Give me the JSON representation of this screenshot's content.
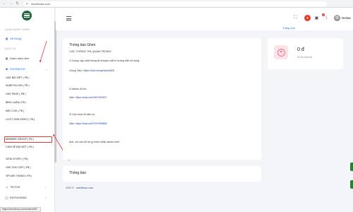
{
  "browser": {
    "url": "new.fbnuu.com"
  },
  "sidebar": {
    "section_admin": "QUẢN HÀNH CHÍNH",
    "item_system": "Hệ thống",
    "section_service": "DỊCH VỤ",
    "item_orders": "Danh sách đơn",
    "group_facebook": "FACEBOOK",
    "facebook_items": [
      "LIKE BÀI VIẾT ( FB )",
      "SUB/FOLLOW ( FB )",
      "LIKE PAGE ( FB )",
      "BÌNH LUẬN ( FB )",
      "MẮT LIVE ( FB )",
      "LƯỢT XEM VIDEO ( FB )",
      "MEMBER GROUP ( FB )",
      "CHIA SẺ BÀI VIẾT ( FB )",
      "VIEW STORY ( FB )",
      "LIKE CHO CMT ( FB )",
      "VIPLIKE THÁNG ( FB )"
    ],
    "group_tiktok": "TIKTOK",
    "group_instagram": "INSTAGRAM"
  },
  "topbar": {
    "username": "NeNar",
    "badge": "1",
    "right_link": "Trang chủ"
  },
  "notice": {
    "title": "Thông báo Ghim",
    "heading": "CÁC THÔNG TIN QUAN TRỌNG",
    "line1": "1/ Group cập nhật thông tin khuyến mãi & hướng dẫn sử dụng",
    "group_label": "Group Zalo: ",
    "group_link": "https://zalo.me/g/mtpwo526",
    "line2": "2/ Admin hỗ trợ",
    "admin_label": "Zalo: ",
    "admin_link": "https://zalo.me/0367493397",
    "line3": "3/ Cần mua hỗ dịch vụ",
    "buy_label": "Zalo: ",
    "buy_link": "https://zalo.me/0767905858",
    "closing": "Anh, chị cần hỗ trợ gì thêm nhắn admin nhé!"
  },
  "notice2": {
    "title": "Thông báo"
  },
  "stats": {
    "value": "0 đ",
    "label": "Số dư hiện tại"
  },
  "footer": {
    "copyright": "2020 © - ",
    "site": "new.fbnuu.com"
  },
  "statusbar": {
    "text": "https://new.fbnuu.com/order/m09"
  }
}
